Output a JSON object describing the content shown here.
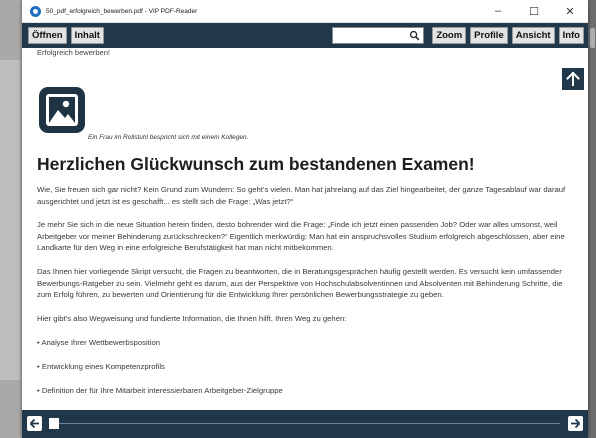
{
  "window": {
    "title": "50_pdf_erfolgreich_bewerben.pdf - VIP PDF-Reader",
    "minimize": "–",
    "maximize": "☐",
    "close": "✕"
  },
  "toolbar": {
    "open_label": "Öffnen",
    "contents_label": "Inhalt",
    "search_value": "",
    "search_placeholder": "",
    "zoom_label": "Zoom",
    "profile_label": "Profile",
    "view_label": "Ansicht",
    "info_label": "Info"
  },
  "document": {
    "running_head": "Erfolgreich bewerben!",
    "image_caption": "Ein Frau im Rollstuhl bespricht sich mit einem Kollegen.",
    "heading": "Herzlichen Glückwunsch zum bestandenen Examen!",
    "paragraphs": [
      "Wie, Sie freuen sich gar nicht? Kein Grund zum Wundern: So geht’s vielen. Man hat jahrelang auf das Ziel hingearbeitet, der ganze Tagesablauf war darauf ausgerichtet und jetzt ist es geschafft... es stellt sich die Frage: „Was jetzt?“",
      "Je mehr Sie sich in die neue Situation herein finden, desto bohrender wird die Frage: „Finde ich jetzt einen passenden Job? Oder war alles umsonst, weil Arbeitgeber vor meiner Behinderung zurückschrecken?“ Eigentlich merkwürdig: Man hat ein anspruchsvolles Studium erfolgreich abgeschlossen, aber eine Landkarte für den Weg in eine erfolgreiche Berufstätigkeit hat man nicht mitbekommen.",
      "Das Ihnen hier vorliegende Skript versucht, die Fragen zu beantworten, die in Beratungsgesprächen häufig gestellt werden. Es versucht kein umfassender Bewerbungs-Ratgeber zu sein. Vielmehr geht es darum, aus der Perspektive von Hochschulabsolventinnen und Absolventen mit Behinderung Schritte, die zum Erfolg führen, zu bewerten und Orientierung für die Entwicklung Ihrer persönlichen Bewerbungsstrategie zu geben.",
      "Hier gibt’s also Wegweisung und fundierte Information, die Ihnen hilft, Ihren Weg zu gehen:",
      "• Analyse Ihrer Wettbewerbsposition",
      "• Entwicklung eines Kompetenzprofils",
      "• Definition der für Ihre Mitarbeit interessierbaren Arbeitgeber-Zielgruppe"
    ]
  },
  "navigation": {
    "page_position": 0
  },
  "icons": {
    "app": "app-icon",
    "search": "search-icon",
    "up": "arrow-up-icon",
    "image": "image-placeholder-icon",
    "prev": "arrow-left-icon",
    "next": "arrow-right-icon"
  },
  "colors": {
    "toolbar_bg": "#21384a",
    "button_bg": "#e2e2e2",
    "heading": "#1e1e1e",
    "body_text": "#3a3a3a"
  }
}
